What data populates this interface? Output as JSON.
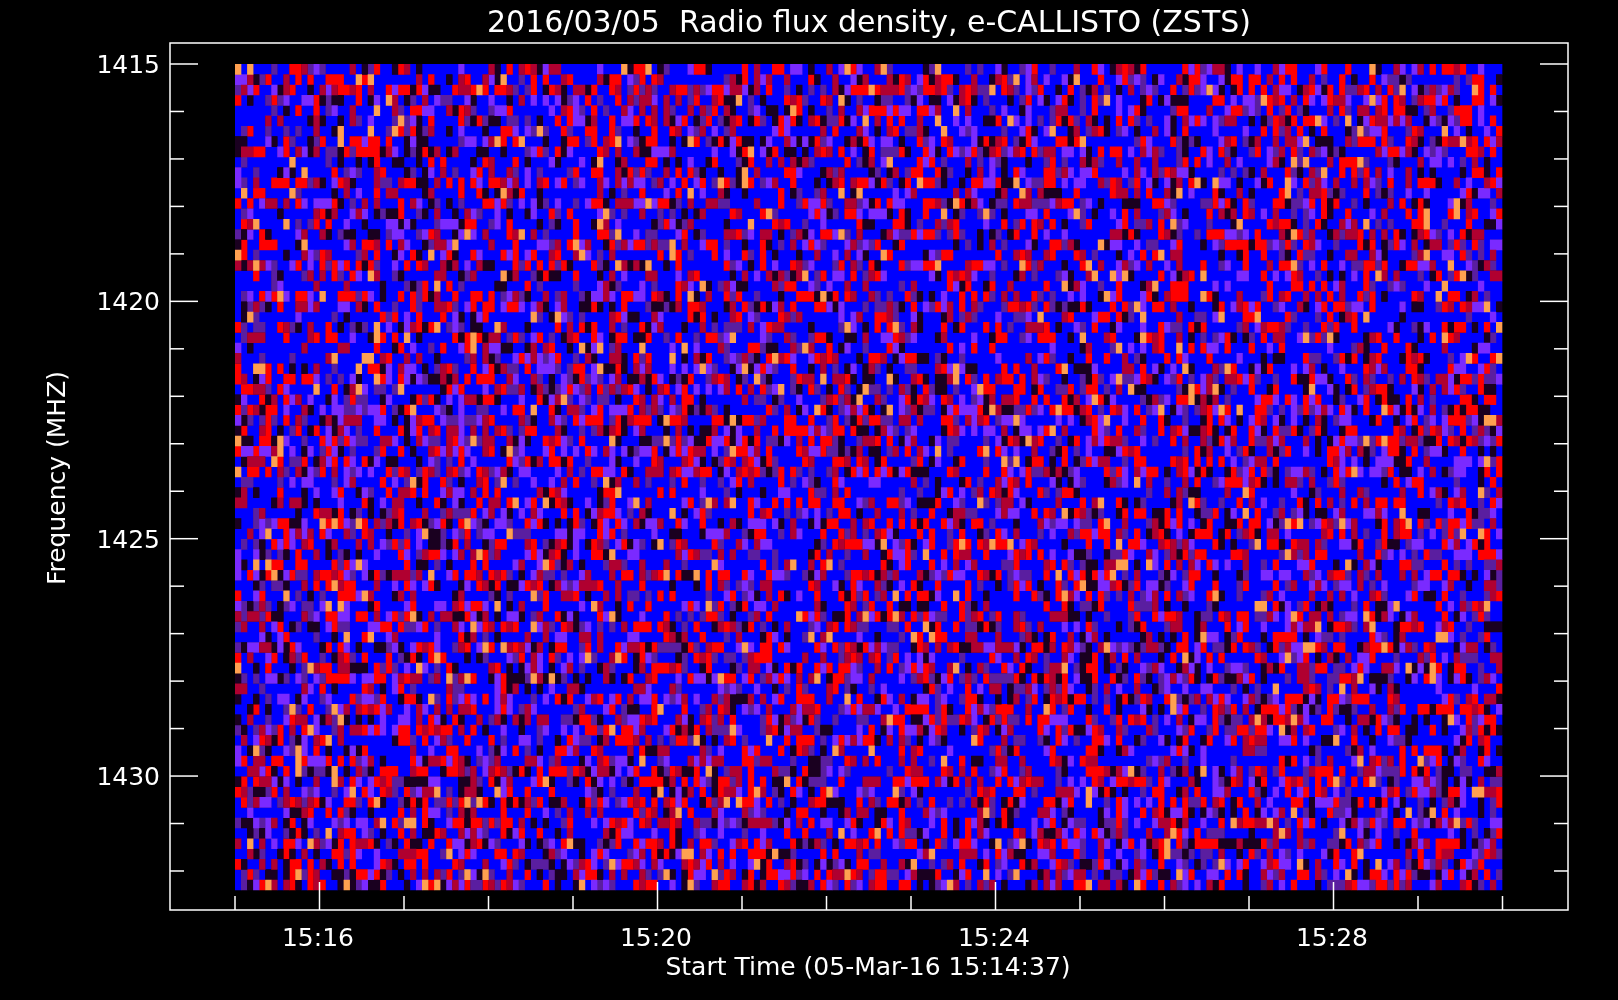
{
  "plot": {
    "title": "2016/03/05  Radio flux density, e-CALLISTO (ZSTS)",
    "xlabel": "Start Time (05-Mar-16 15:14:37)",
    "ylabel": "Frequency (MHZ)",
    "xticks": [
      "15:16",
      "15:20",
      "15:24",
      "15:28"
    ],
    "yticks": [
      "1415",
      "1420",
      "1425",
      "1430"
    ]
  }
}
